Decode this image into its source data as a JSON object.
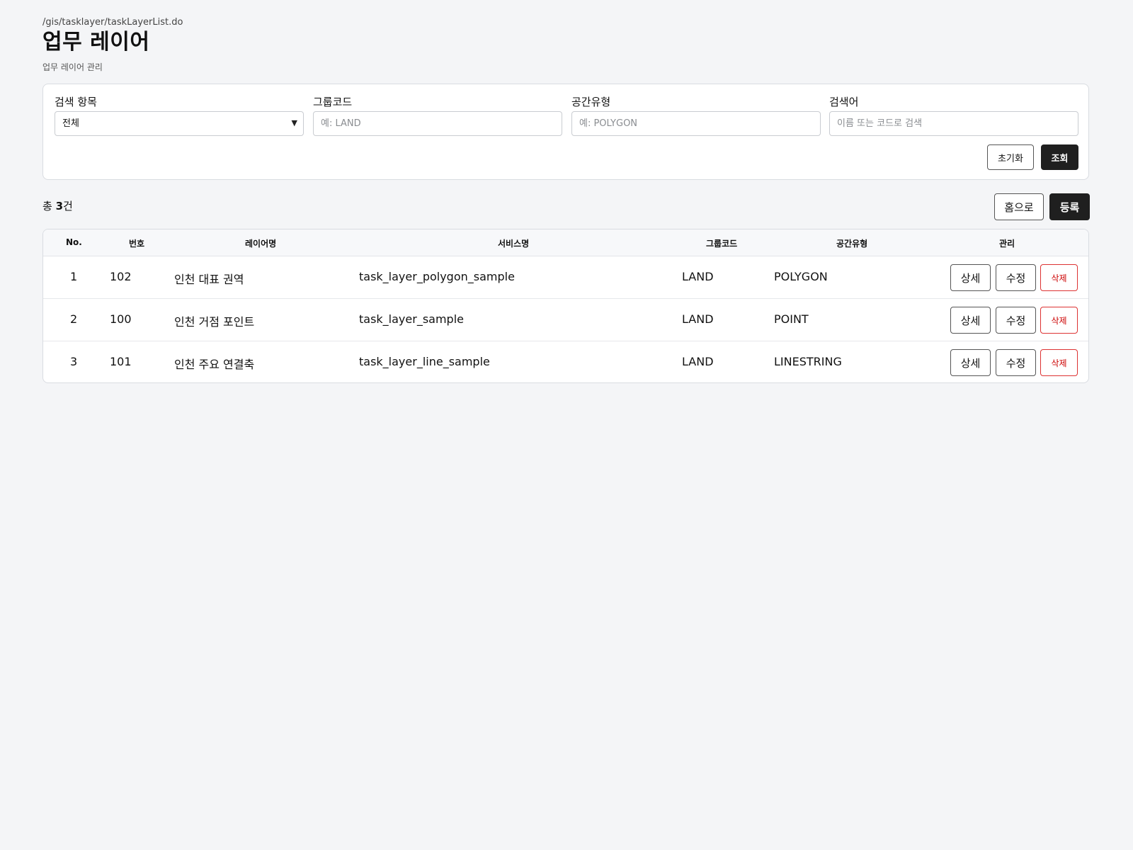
{
  "header": {
    "path": "/gis/tasklayer/taskLayerList.do",
    "title": "업무 레이어",
    "subtitle": "업무 레이어 관리"
  },
  "search": {
    "field_label": "검색 항목",
    "field_value": "전체",
    "group_label": "그룹코드",
    "group_placeholder": "예: LAND",
    "spatial_label": "공간유형",
    "spatial_placeholder": "예: POLYGON",
    "keyword_label": "검색어",
    "keyword_placeholder": "이름 또는 코드로 검색",
    "reset_label": "초기화",
    "search_label": "조회"
  },
  "summary": {
    "prefix": "총 ",
    "count": "3",
    "suffix": "건"
  },
  "actions": {
    "home_label": "홈으로",
    "register_label": "등록"
  },
  "table": {
    "headers": {
      "no": "No.",
      "id": "번호",
      "layer_name": "레이어명",
      "service_name": "서비스명",
      "group_code": "그룹코드",
      "spatial_type": "공간유형",
      "manage": "관리"
    },
    "rows": [
      {
        "no": "1",
        "id": "102",
        "layer_name": "인천 대표 권역",
        "service_name": "task_layer_polygon_sample",
        "group_code": "LAND",
        "spatial_type": "POLYGON",
        "detail": "상세",
        "edit": "수정",
        "delete": "삭제"
      },
      {
        "no": "2",
        "id": "100",
        "layer_name": "인천 거점 포인트",
        "service_name": "task_layer_sample",
        "group_code": "LAND",
        "spatial_type": "POINT",
        "detail": "상세",
        "edit": "수정",
        "delete": "삭제"
      },
      {
        "no": "3",
        "id": "101",
        "layer_name": "인천 주요 연결축",
        "service_name": "task_layer_line_sample",
        "group_code": "LAND",
        "spatial_type": "LINESTRING",
        "detail": "상세",
        "edit": "수정",
        "delete": "삭제"
      }
    ]
  },
  "colors": {
    "background": "#f4f5f7",
    "primary_button": "#1f1f1f",
    "danger": "#cc0000"
  }
}
